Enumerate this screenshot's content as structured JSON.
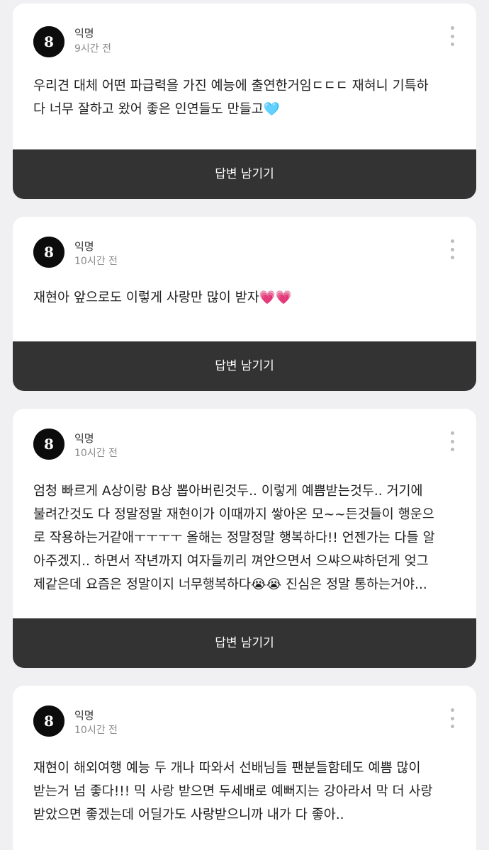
{
  "posts": [
    {
      "author": "익명",
      "time": "9시간 전",
      "body": "우리견 대체 어떤 파급력을 가진 예능에 출연한거임ㄷㄷㄷ 재혀니 기특하\n다 너무 잘하고 왔어 좋은 인연들도 만들고🩵",
      "reply_label": "답변 남기기",
      "icon": "more-vertical-icon"
    },
    {
      "author": "익명",
      "time": "10시간 전",
      "body": "재현아 앞으로도 이렇게 사랑만 많이 받자💗💗",
      "reply_label": "답변 남기기",
      "icon": "more-vertical-icon"
    },
    {
      "author": "익명",
      "time": "10시간 전",
      "body": "엄청 빠르게 A상이랑 B상 뽑아버린것두.. 이렇게 예쁨받는것두.. 거기에\n불려간것도 다 정말정말 재현이가 이때까지 쌓아온 모~~든것들이 행운으\n로 작용하는거같애ㅜㅜㅜㅜ 올해는 정말정말 행복하다!! 언젠가는 다들 알\n아주겠지.. 하면서 작년까지 여자들끼리 껴안으면서 으쌰으쌰하던게 엊그\n제같은데 요즘은 정말이지 너무행복하다😭😭 진심은 정말 통하는거야...",
      "reply_label": "답변 남기기",
      "icon": "more-vertical-icon"
    },
    {
      "author": "익명",
      "time": "10시간 전",
      "body": "재현이 해외여행 예능 두 개나 따와서 선배님들 팬분들함테도 예쁨 많이\n받는거 넘 좋다!!! 믹 사랑 받으면 두세배로 예뻐지는 강아라서 막 더 사랑\n받았으면 좋겠는데 어딜가도 사랑받으니까 내가 다 좋아..",
      "icon": "more-vertical-icon"
    }
  ]
}
